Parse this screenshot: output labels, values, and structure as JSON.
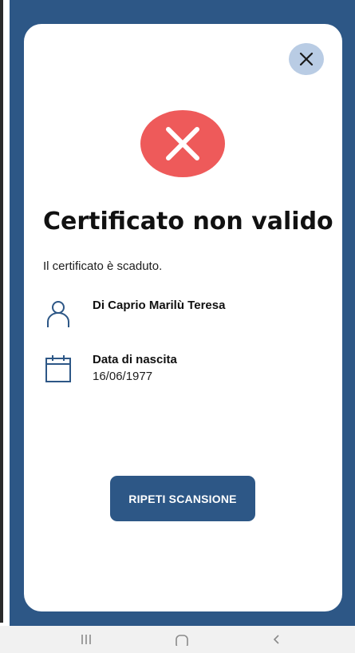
{
  "dialog": {
    "title": "Certificato non valido",
    "message": "Il certificato è scaduto.",
    "status_icon": "x-icon",
    "status_color": "#ee5a5a",
    "close_icon": "close-icon"
  },
  "holder": {
    "icon": "person-icon",
    "name": "Di Caprio Marilù Teresa"
  },
  "birth": {
    "icon": "calendar-icon",
    "label": "Data di nascita",
    "value": "16/06/1977"
  },
  "actions": {
    "rescan_label": "RIPETI SCANSIONE"
  },
  "colors": {
    "primary": "#2d5786",
    "close_bg": "#b9cce4",
    "error": "#ee5a5a"
  },
  "navbar": {
    "recents_icon": "recents-icon",
    "home_icon": "home-icon",
    "back_icon": "back-icon"
  }
}
